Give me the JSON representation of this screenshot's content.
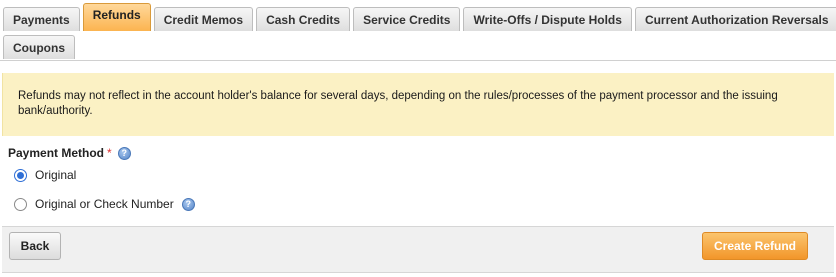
{
  "tabs": {
    "row1": [
      "Payments",
      "Refunds",
      "Credit Memos",
      "Cash Credits",
      "Service Credits",
      "Write-Offs / Dispute Holds",
      "Current Authorization Reversals"
    ],
    "row2": [
      "Coupons"
    ],
    "active": "Refunds"
  },
  "notice": {
    "text": "Refunds may not reflect in the account holder's balance for several days, depending on the rules/processes of the payment processor and the issuing bank/authority."
  },
  "payment_method": {
    "label": "Payment Method",
    "required_marker": "*",
    "help_icon": "question-help-icon",
    "options": [
      {
        "label": "Original",
        "selected": true
      },
      {
        "label": "Original or Check Number",
        "selected": false
      }
    ]
  },
  "footer": {
    "back_label": "Back",
    "create_label": "Create Refund"
  },
  "colors": {
    "active_tab": "#fbb450",
    "notice_bg": "#fbf1c4",
    "create_button": "#f2962a",
    "radio_selected": "#2f6fd6"
  }
}
